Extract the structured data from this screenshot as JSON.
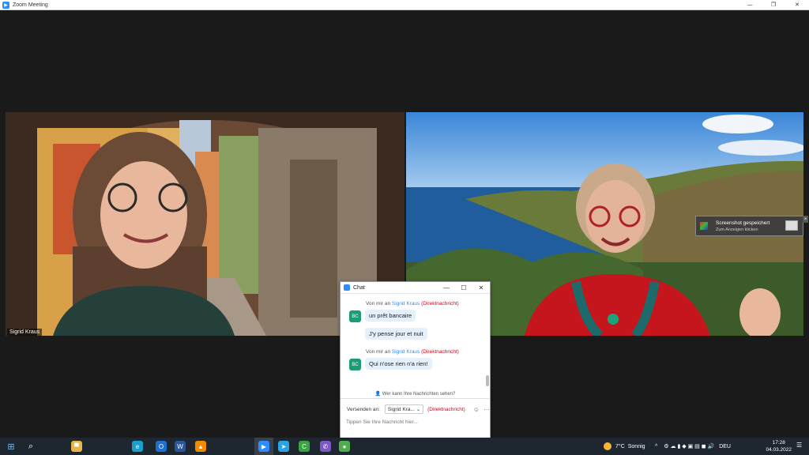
{
  "window": {
    "title": "Zoom Meeting",
    "minimize_glyph": "—",
    "restore_glyph": "❐",
    "close_glyph": "✕"
  },
  "participants": [
    {
      "name": "Sigrid Kraus"
    },
    {
      "name": ""
    }
  ],
  "toast": {
    "title": "Screenshot gespeichert",
    "subtitle": "Zum Anzeigen klicken",
    "close_glyph": "×"
  },
  "chat": {
    "title": "Chat",
    "minimize_glyph": "—",
    "maximize_glyph": "☐",
    "close_glyph": "✕",
    "messages": [
      {
        "header_prefix": "Von mir an",
        "recipient": "Sigrid Kraus",
        "dm": "(Direktnachricht)",
        "avatar": "BC",
        "lines": [
          "un prêt bancaire",
          "J'y  pense jour et nuit"
        ]
      },
      {
        "header_prefix": "Von mir an",
        "recipient": "Sigrid Kraus",
        "dm": "(Direktnachricht)",
        "avatar": "BC",
        "lines": [
          "Qui n'ose rien n'a rien!"
        ]
      }
    ],
    "who_sees": "Wer kann Ihre Nachrichten sehen?",
    "send_to_label": "Versenden an:",
    "recipient_select": "Sigrid Kra...",
    "recipient_select_chevron": "⌄",
    "recipient_dm": "(Direktnachricht)",
    "emoji_glyph": "☺",
    "more_glyph": "···",
    "input_placeholder": "Tippen Sie Ihre Nachricht hier..."
  },
  "taskbar": {
    "start_glyph": "⊞",
    "search_glyph": "⌕",
    "weather_temp": "7°C",
    "weather_text": "Sonnig",
    "tray_chevron": "^",
    "language": "DEU",
    "time": "17:28",
    "date": "04.03.2022",
    "notification_glyph": "☰",
    "app_icons": [
      {
        "name": "explorer-app-icon",
        "color": "#e8b54a",
        "glyph": "▀"
      },
      {
        "name": "edge-app-icon",
        "color": "#1aa1c9",
        "glyph": "e"
      },
      {
        "name": "outlook-app-icon",
        "color": "#1f6fd1",
        "glyph": "O"
      },
      {
        "name": "chrome-app-icon",
        "color": "#4caf50",
        "glyph": "●"
      },
      {
        "name": "word-app-icon",
        "color": "#2b579a",
        "glyph": "W"
      },
      {
        "name": "vlc-app-icon",
        "color": "#f08a00",
        "glyph": "▲"
      },
      {
        "name": "zoom-app-icon",
        "color": "#2d8cff",
        "glyph": "▶"
      },
      {
        "name": "telegram-app-icon",
        "color": "#2aa3e0",
        "glyph": "➤"
      },
      {
        "name": "camtasia-app-icon",
        "color": "#3aa343",
        "glyph": "C"
      },
      {
        "name": "viber-app-icon",
        "color": "#7b58c6",
        "glyph": "✆"
      }
    ]
  }
}
